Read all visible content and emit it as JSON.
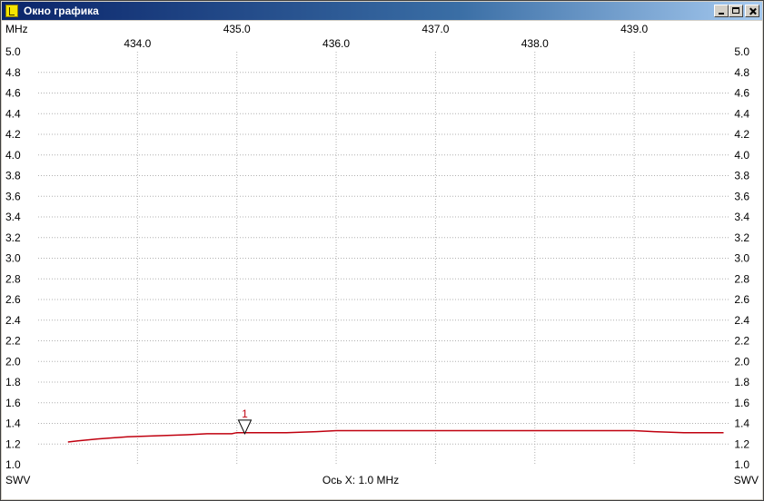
{
  "window": {
    "title": "Окно графика",
    "controls": {
      "minimize_icon": "minimize-icon",
      "maximize_icon": "maximize-icon",
      "close_icon": "close-icon"
    },
    "app_icon": "chart-app-icon"
  },
  "colors": {
    "trace": "#c0000f",
    "grid": "#b0b0b0",
    "title_gradient_start": "#0a246a",
    "title_gradient_end": "#a6caf0"
  },
  "chart_data": {
    "type": "line",
    "x_unit_label": "MHz",
    "xlabel": "Ось X: 1.0 MHz",
    "ylabel_left": "SWV",
    "ylabel_right": "SWV",
    "xlim": [
      433.0,
      439.95
    ],
    "ylim": [
      1.0,
      5.0
    ],
    "x_ticks_row1": [
      "435.0",
      "437.0",
      "439.0"
    ],
    "x_ticks_row2": [
      "434.0",
      "436.0",
      "438.0"
    ],
    "y_ticks": [
      "5.0",
      "4.8",
      "4.6",
      "4.4",
      "4.2",
      "4.0",
      "3.8",
      "3.6",
      "3.4",
      "3.2",
      "3.0",
      "2.8",
      "2.6",
      "2.4",
      "2.2",
      "2.0",
      "1.8",
      "1.6",
      "1.4",
      "1.2",
      "1.0"
    ],
    "grid": true,
    "grid_style": "dotted",
    "series": [
      {
        "x": [
          433.3,
          433.4,
          433.6,
          433.9,
          434.2,
          434.5,
          434.7,
          434.95,
          435.0,
          435.2,
          435.5,
          435.8,
          436.0,
          436.5,
          437.0,
          437.5,
          438.0,
          438.5,
          439.0,
          439.2,
          439.5,
          439.9
        ],
        "y": [
          1.22,
          1.23,
          1.25,
          1.27,
          1.28,
          1.29,
          1.3,
          1.3,
          1.31,
          1.31,
          1.31,
          1.32,
          1.33,
          1.33,
          1.33,
          1.33,
          1.33,
          1.33,
          1.33,
          1.32,
          1.31,
          1.31
        ]
      }
    ],
    "markers": [
      {
        "label": "1",
        "x": 435.08,
        "y": 1.3
      }
    ]
  }
}
